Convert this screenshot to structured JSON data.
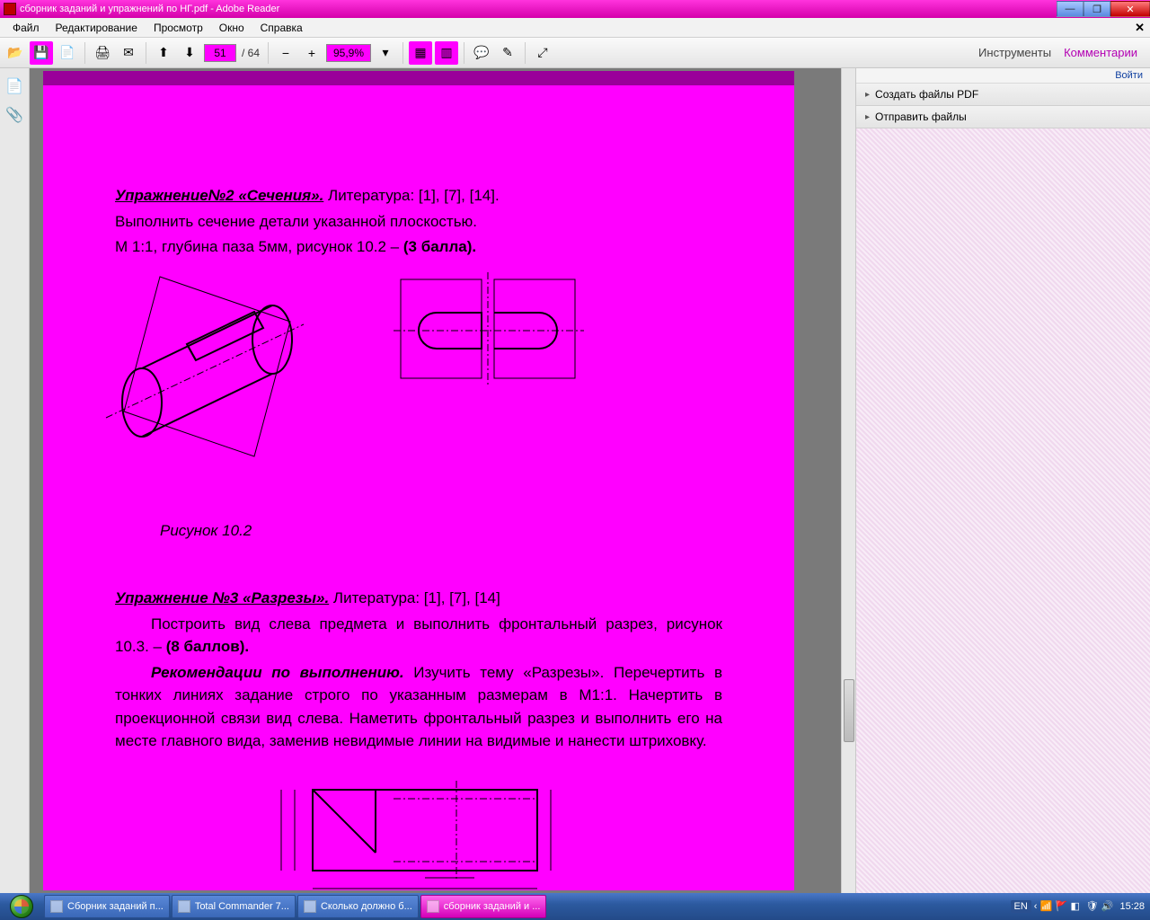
{
  "window": {
    "title": "сборник заданий и упражнений по НГ.pdf - Adobe Reader"
  },
  "menu": {
    "file": "Файл",
    "edit": "Редактирование",
    "view": "Просмотр",
    "window": "Окно",
    "help": "Справка"
  },
  "toolbar": {
    "page_current": "51",
    "page_total": "/ 64",
    "zoom": "95,9%",
    "tools": "Инструменты",
    "comments": "Комментарии"
  },
  "right": {
    "login": "Войти",
    "create_pdf": "Создать файлы PDF",
    "send_files": "Отправить файлы"
  },
  "document": {
    "ex2_head": "Упражнение№2 «Сечения».",
    "ex2_lit": " Литература: [1], [7], [14].",
    "ex2_line2": "Выполнить сечение детали указанной плоскостью.",
    "ex2_line3a": "М 1:1, глубина паза 5мм, рисунок 10.2 – ",
    "ex2_line3b": "(3 балла).",
    "fig102": "Рисунок 10.2",
    "ex3_head": "Упражнение №3 «Разрезы».",
    "ex3_lit": " Литература: [1], [7], [14]",
    "ex3_p1": "Построить вид слева предмета и выполнить фронтальный разрез, рисунок 10.3. – ",
    "ex3_p1b": "(8 баллов).",
    "ex3_rec_head": "Рекомендации по выполнению.",
    "ex3_rec": " Изучить тему «Разрезы». Перечертить в тонких линиях задание строго по указанным размерам в М1:1. Начертить в проекционной связи вид слева. Наметить фронтальный разрез и выполнить его на месте главного вида, заменив невидимые линии на видимые и нанести штриховку."
  },
  "taskbar": {
    "items": [
      "Сборник заданий п...",
      "Total Commander 7...",
      "Сколько должно б...",
      "сборник заданий и ..."
    ],
    "lang": "EN",
    "clock": "15:28"
  }
}
